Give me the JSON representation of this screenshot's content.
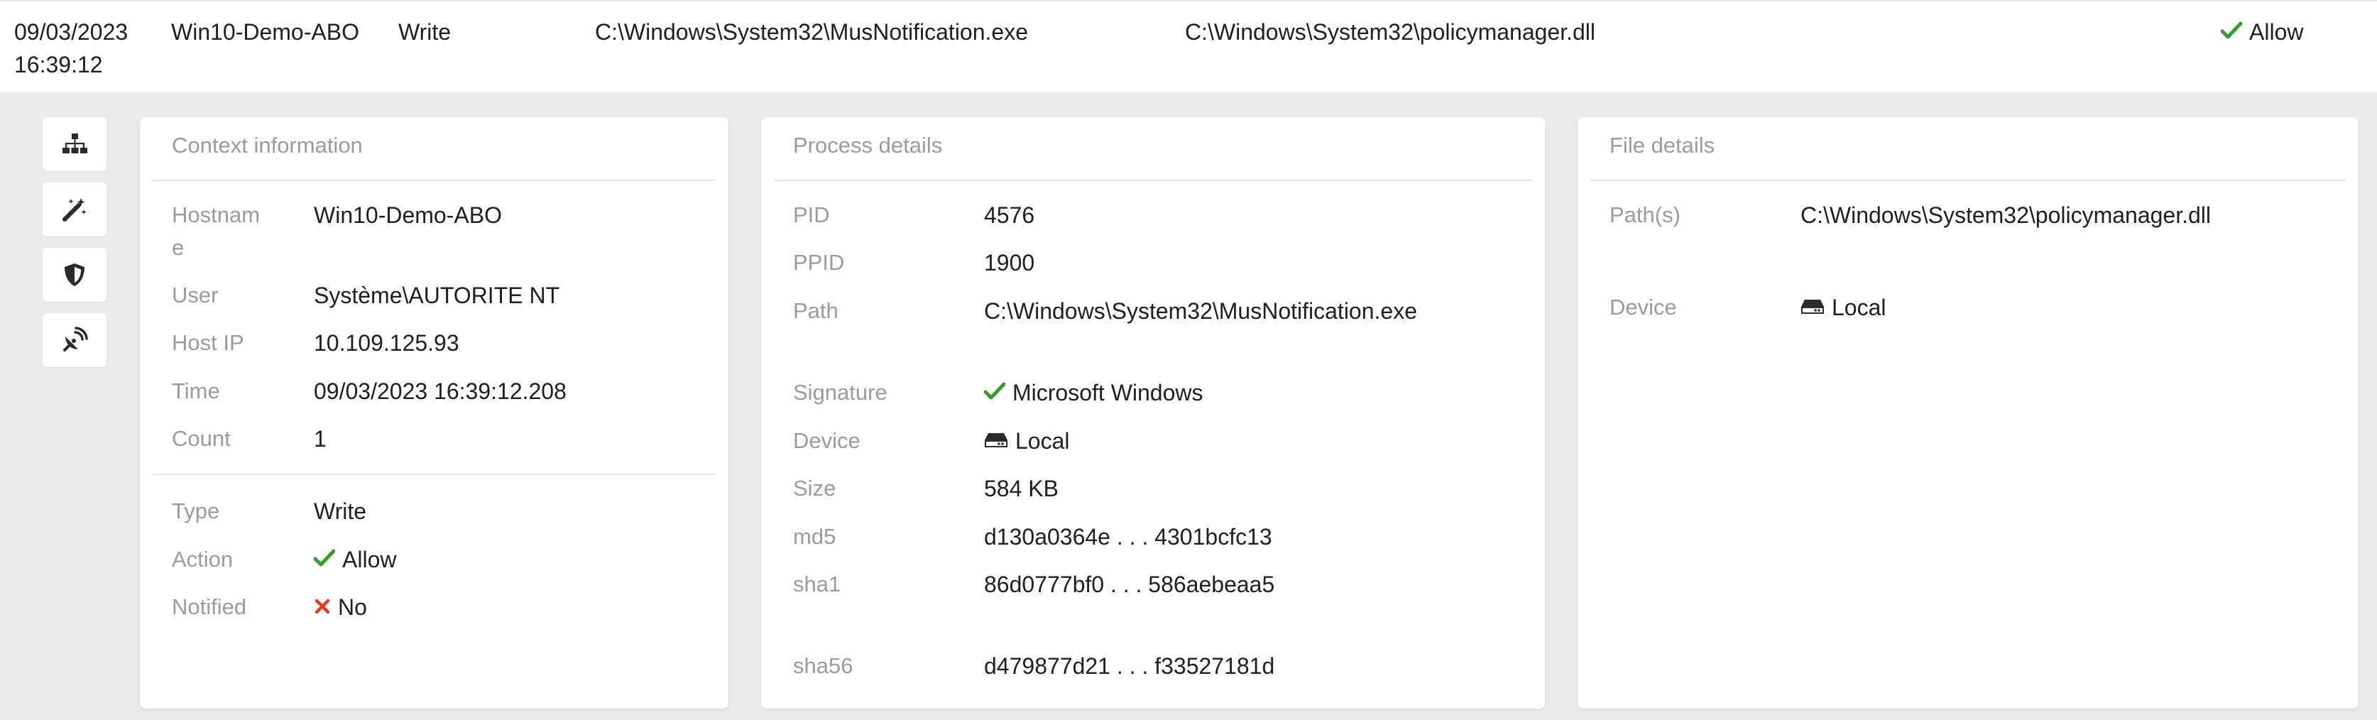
{
  "row": {
    "timestamp": "09/03/2023 16:39:12",
    "hostname": "Win10-Demo-ABO",
    "type": "Write",
    "process_path": "C:\\Windows\\System32\\MusNotification.exe",
    "file_path": "C:\\Windows\\System32\\policymanager.dll",
    "action": "Allow"
  },
  "sidebar_icons": [
    "hierarchy-icon",
    "magic-wand-icon",
    "shield-icon",
    "satellite-dish-icon"
  ],
  "context": {
    "title": "Context information",
    "hostname_label": "Hostnam\ne",
    "hostname": "Win10-Demo-ABO",
    "user_label": "User",
    "user": "Système\\AUTORITE NT",
    "hostip_label": "Host IP",
    "hostip": "10.109.125.93",
    "time_label": "Time",
    "time": "09/03/2023 16:39:12.208",
    "count_label": "Count",
    "count": "1",
    "type_label": "Type",
    "type": "Write",
    "action_label": "Action",
    "action": "Allow",
    "notified_label": "Notified",
    "notified": "No"
  },
  "process": {
    "title": "Process details",
    "pid_label": "PID",
    "pid": "4576",
    "ppid_label": "PPID",
    "ppid": "1900",
    "path_label": "Path",
    "path": "C:\\Windows\\System32\\MusNotification.exe",
    "signature_label": "Signature",
    "signature": "Microsoft Windows",
    "device_label": "Device",
    "device": "Local",
    "size_label": "Size",
    "size": "584 KB",
    "md5_label": "md5",
    "md5": "d130a0364e . . . 4301bcfc13",
    "sha1_label": "sha1",
    "sha1": "86d0777bf0 . . . 586aebeaa5",
    "sha56_label": "sha56",
    "sha56": "d479877d21 . . . f33527181d"
  },
  "file": {
    "title": "File details",
    "paths_label": "Path(s)",
    "paths": "C:\\Windows\\System32\\policymanager.dll",
    "device_label": "Device",
    "device": "Local"
  },
  "colors": {
    "allow": "#3a9a2f",
    "deny": "#e43a2e",
    "label": "#9b9b9b",
    "background": "#ebebeb"
  }
}
